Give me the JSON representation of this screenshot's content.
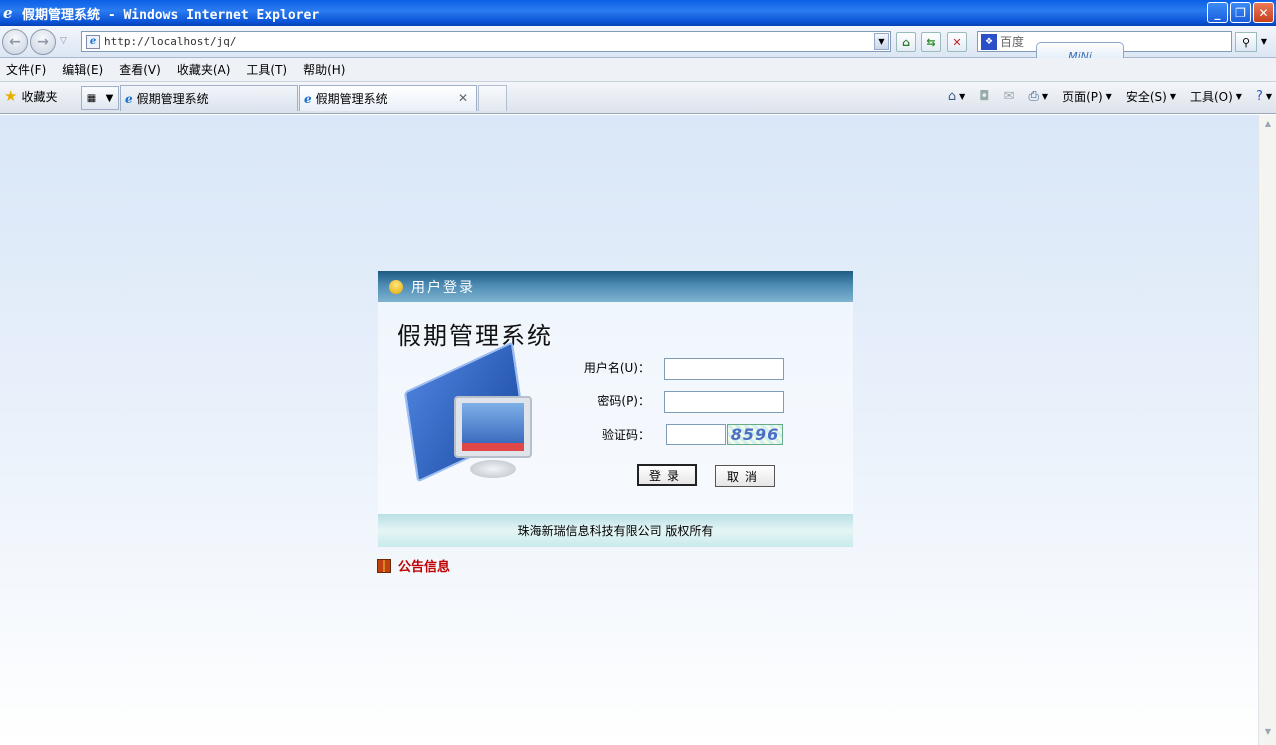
{
  "window": {
    "title": "假期管理系统 - Windows Internet Explorer",
    "controls": {
      "minimize": "_",
      "restore": "❐",
      "close": "✕"
    }
  },
  "address_bar": {
    "url": "http://localhost/jq/",
    "search_placeholder": "百度",
    "mini_badge": "MiNi"
  },
  "menu": [
    "文件(F)",
    "编辑(E)",
    "查看(V)",
    "收藏夹(A)",
    "工具(T)",
    "帮助(H)"
  ],
  "favorites_label": "收藏夹",
  "tabs": [
    {
      "label": "假期管理系统",
      "active": false
    },
    {
      "label": "假期管理系统",
      "active": true
    }
  ],
  "command_bar": {
    "page": "页面(P)",
    "safety": "安全(S)",
    "tools": "工具(O)"
  },
  "login": {
    "header": "用户登录",
    "system_title": "假期管理系统",
    "username_label": "用户名(U)：",
    "password_label": "密码(P)：",
    "captcha_label": "验证码：",
    "username_value": "",
    "password_value": "",
    "captcha_value": "",
    "captcha_image_text": "8596",
    "login_button": "登录",
    "cancel_button": "取消",
    "footer": "珠海新瑞信息科技有限公司 版权所有"
  },
  "notice": {
    "title": "公告信息"
  },
  "colors": {
    "titlebar": "#0a5fe6",
    "login_header": "#1f5a83",
    "notice_text": "#c00000"
  },
  "icons": [
    "ie-icon",
    "back-icon",
    "forward-icon",
    "refresh-icon",
    "stop-icon",
    "search-icon",
    "favorites-star-icon",
    "home-icon",
    "feed-icon",
    "mail-icon",
    "print-icon",
    "help-icon",
    "user-icon",
    "gift-icon"
  ]
}
